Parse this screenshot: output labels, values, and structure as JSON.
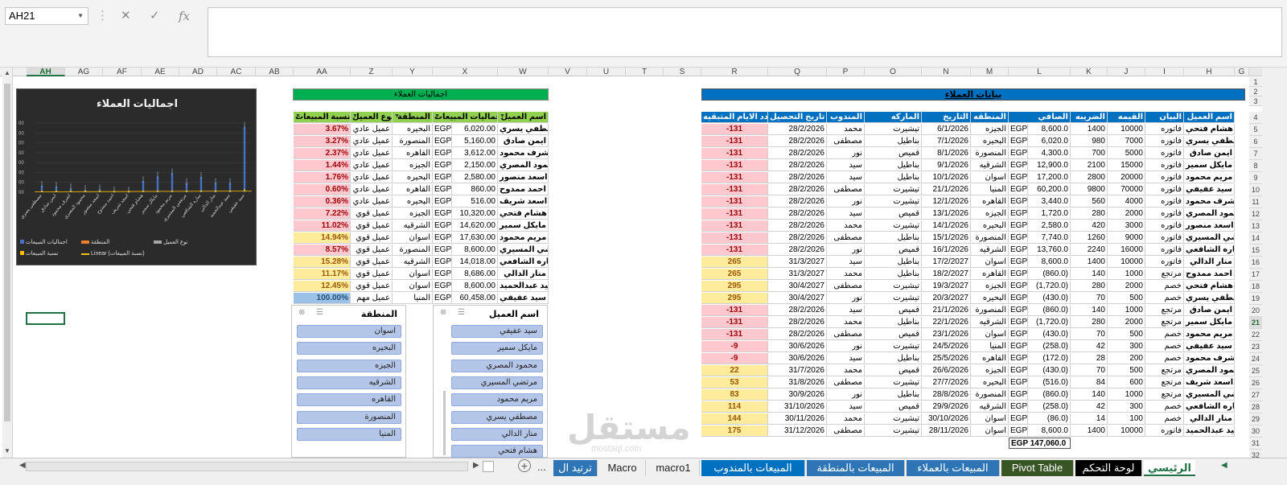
{
  "name_box": "AH21",
  "formula_icons": {
    "cancel": "✕",
    "enter": "✓",
    "fx": "fx"
  },
  "columns": [
    "AH",
    "AG",
    "AF",
    "AE",
    "AD",
    "AC",
    "AB",
    "AA",
    "Z",
    "Y",
    "X",
    "W",
    "V",
    "U",
    "T",
    "S",
    "R",
    "Q",
    "P",
    "O",
    "N",
    "M",
    "L",
    "K",
    "J",
    "I",
    "H",
    "G"
  ],
  "rows": [
    "1",
    "2",
    "3",
    "4",
    "5",
    "6",
    "7",
    "8",
    "9",
    "10",
    "11",
    "12",
    "13",
    "14",
    "15",
    "16",
    "17",
    "18",
    "19",
    "20",
    "21",
    "22",
    "23",
    "24",
    "25",
    "26",
    "27",
    "28",
    "29",
    "30",
    "31",
    "32"
  ],
  "chart": {
    "chart_data": {
      "type": "bar",
      "title": "اجماليات العملاء",
      "categories": [
        "مصطفى يسري",
        "ايمن صادق",
        "اشرف محمود",
        "محمود المصري",
        "اسعد منصور",
        "احمد ممدوح",
        "اسعد شريف",
        "هشام فتحي",
        "مايكل سمير",
        "مريم محمود",
        "مرتضي المسيري",
        "ساره الشافعي",
        "منار الدالي",
        "سيد عبدالحميد",
        "سيد عفيفي"
      ],
      "series": [
        {
          "name": "اجماليات المبيعات",
          "values": [
            6020,
            5160,
            3612,
            2150,
            2580,
            860,
            516,
            10320,
            14620,
            17630,
            8600,
            14018,
            8686,
            8600,
            60458
          ]
        },
        {
          "name": "نسبة المبيعات",
          "values": [
            3.67,
            3.27,
            2.37,
            1.44,
            1.76,
            0.6,
            0.36,
            7.22,
            11.02,
            14.94,
            8.57,
            15.28,
            11.17,
            12.45,
            100.0
          ]
        }
      ],
      "legend": [
        "اجماليات المبيعات",
        "المنطقة",
        "نوع العميل",
        "نسبة المبيعات",
        "Linear (نسبة المبيعات)"
      ]
    }
  },
  "pivot": {
    "title": "اجماليات العملاء",
    "headers": [
      "اسم العميل",
      "اجماليات المبيعات",
      "المنطقة",
      "نوع العميل",
      "نسبة المبيعات"
    ],
    "currency": "EGP",
    "rows": [
      {
        "name": "مصطفي يسري",
        "total": "6,020.00",
        "region": "البحيره",
        "type": "عميل عادي",
        "pct": "3.67%",
        "c": "pink"
      },
      {
        "name": "ايمن صادق",
        "total": "5,160.00",
        "region": "المنصورة",
        "type": "عميل عادي",
        "pct": "3.27%",
        "c": "pink"
      },
      {
        "name": "اشرف محمود",
        "total": "3,612.00",
        "region": "القاهره",
        "type": "عميل عادي",
        "pct": "2.37%",
        "c": "pink"
      },
      {
        "name": "محمود المصري",
        "total": "2,150.00",
        "region": "الجيزه",
        "type": "عميل عادي",
        "pct": "1.44%",
        "c": "pink"
      },
      {
        "name": "اسعد منصور",
        "total": "2,580.00",
        "region": "البحيره",
        "type": "عميل عادي",
        "pct": "1.76%",
        "c": "pink"
      },
      {
        "name": "احمد ممدوح",
        "total": "860.00",
        "region": "القاهره",
        "type": "عميل عادي",
        "pct": "0.60%",
        "c": "pink"
      },
      {
        "name": "اسعد شريف",
        "total": "516.00",
        "region": "البحيره",
        "type": "عميل عادي",
        "pct": "0.36%",
        "c": "pink"
      },
      {
        "name": "هشام فتحي",
        "total": "10,320.00",
        "region": "الجيزه",
        "type": "عميل قوي",
        "pct": "7.22%",
        "c": "pink"
      },
      {
        "name": "مايكل سمير",
        "total": "14,620.00",
        "region": "الشرقيه",
        "type": "عميل قوي",
        "pct": "11.02%",
        "c": "pink"
      },
      {
        "name": "مريم محمود",
        "total": "17,630.00",
        "region": "اسوان",
        "type": "عميل قوي",
        "pct": "14.94%",
        "c": "yel"
      },
      {
        "name": "مرتضي المسيري",
        "total": "8,600.00",
        "region": "المنصورة",
        "type": "عميل قوي",
        "pct": "8.57%",
        "c": "pink"
      },
      {
        "name": "ساره الشافعي",
        "total": "14,018.00",
        "region": "الشرقيه",
        "type": "عميل قوي",
        "pct": "15.28%",
        "c": "yel"
      },
      {
        "name": "منار الدالي",
        "total": "8,686.00",
        "region": "اسوان",
        "type": "عميل قوي",
        "pct": "11.17%",
        "c": "yel"
      },
      {
        "name": "سيد عبدالحميد",
        "total": "8,600.00",
        "region": "اسوان",
        "type": "عميل قوي",
        "pct": "12.45%",
        "c": "yel"
      },
      {
        "name": "سيد عفيفي",
        "total": "60,458.00",
        "region": "المنيا",
        "type": "عميل مهم",
        "pct": "100.00%",
        "c": "blue"
      }
    ]
  },
  "slicer_region": {
    "title": "المنطقة",
    "items": [
      "اسوان",
      "البحيره",
      "الجيزه",
      "الشرقيه",
      "القاهره",
      "المنصورة",
      "المنيا"
    ]
  },
  "slicer_customer": {
    "title": "اسم العميل",
    "items": [
      "سيد عفيفي",
      "مايكل سمير",
      "محمود المصري",
      "مرتضي المسيري",
      "مريم محمود",
      "مصطفي يسري",
      "منار الدالي",
      "هشام فتحي"
    ]
  },
  "data_table": {
    "title": "بيانات العملاء",
    "headers": [
      "اسم العميل",
      "البيان",
      "القيمه",
      "الضريبه",
      "الصافي",
      "المنطقه",
      "التاريخ",
      "الماركه",
      "المندوب",
      "تاريخ التحصيل",
      "عدد الايام المتبقيه"
    ],
    "rows": [
      [
        "هشام فتحي",
        "فاتوره",
        "10000",
        "1400",
        "8,600.0",
        "الجيزه",
        "6/1/2026",
        "تيشيرت",
        "محمد",
        "28/2/2026",
        "-131",
        "pink"
      ],
      [
        "مصطفي يسري",
        "فاتوره",
        "7000",
        "980",
        "6,020.0",
        "البحيره",
        "7/1/2026",
        "بناطيل",
        "مصطفى",
        "28/2/2026",
        "-131",
        "pink"
      ],
      [
        "ايمن صادق",
        "فاتوره",
        "5000",
        "700",
        "4,300.0",
        "المنصورة",
        "8/1/2026",
        "قميص",
        "نور",
        "28/2/2026",
        "-131",
        "pink"
      ],
      [
        "مايكل سمير",
        "فاتوره",
        "15000",
        "2100",
        "12,900.0",
        "الشرقيه",
        "9/1/2026",
        "بناطيل",
        "سيد",
        "28/2/2026",
        "-131",
        "pink"
      ],
      [
        "مريم محمود",
        "فاتوره",
        "20000",
        "2800",
        "17,200.0",
        "اسوان",
        "10/1/2026",
        "بناطيل",
        "سيد",
        "28/2/2026",
        "-131",
        "pink"
      ],
      [
        "سيد عفيفي",
        "فاتوره",
        "70000",
        "9800",
        "60,200.0",
        "المنيا",
        "21/1/2026",
        "تيشيرت",
        "مصطفى",
        "28/2/2026",
        "-131",
        "pink"
      ],
      [
        "اشرف محمود",
        "فاتوره",
        "4000",
        "560",
        "3,440.0",
        "القاهره",
        "12/1/2026",
        "تيشيرت",
        "نور",
        "28/2/2026",
        "-131",
        "pink"
      ],
      [
        "محمود المصري",
        "فاتوره",
        "2000",
        "280",
        "1,720.0",
        "الجيزه",
        "13/1/2026",
        "قميص",
        "سيد",
        "28/2/2026",
        "-131",
        "pink"
      ],
      [
        "اسعد منصور",
        "فاتوره",
        "3000",
        "420",
        "2,580.0",
        "البحيره",
        "14/1/2026",
        "تيشيرت",
        "محمد",
        "28/2/2026",
        "-131",
        "pink"
      ],
      [
        "مرتضي المسيري",
        "فاتوره",
        "9000",
        "1260",
        "7,740.0",
        "المنصورة",
        "15/1/2026",
        "بناطيل",
        "مصطفى",
        "28/2/2026",
        "-131",
        "pink"
      ],
      [
        "ساره الشافعي",
        "فاتوره",
        "16000",
        "2240",
        "13,760.0",
        "الشرقيه",
        "16/1/2026",
        "قميص",
        "نور",
        "28/2/2026",
        "-131",
        "pink"
      ],
      [
        "منار الدالي",
        "فاتوره",
        "10000",
        "1400",
        "8,600.0",
        "اسوان",
        "17/2/2027",
        "بناطيل",
        "سيد",
        "31/3/2027",
        "265",
        "yel"
      ],
      [
        "احمد ممدوح",
        "مرتجع",
        "1000",
        "140",
        "(860.0)",
        "القاهره",
        "18/2/2027",
        "بناطيل",
        "محمد",
        "31/3/2027",
        "265",
        "yel"
      ],
      [
        "هشام فتحي",
        "خصم",
        "2000",
        "280",
        "(1,720.0)",
        "الجيزه",
        "19/3/2027",
        "تيشيرت",
        "مصطفى",
        "30/4/2027",
        "295",
        "yel"
      ],
      [
        "مصطفي يسري",
        "خصم",
        "500",
        "70",
        "(430.0)",
        "البحيره",
        "20/3/2027",
        "تيشيرت",
        "نور",
        "30/4/2027",
        "295",
        "yel"
      ],
      [
        "ايمن صادق",
        "مرتجع",
        "1000",
        "140",
        "(860.0)",
        "المنصورة",
        "21/1/2026",
        "قميص",
        "سيد",
        "28/2/2026",
        "-131",
        "pink"
      ],
      [
        "مايكل سمير",
        "مرتجع",
        "2000",
        "280",
        "(1,720.0)",
        "الشرقيه",
        "22/1/2026",
        "بناطيل",
        "محمد",
        "28/2/2026",
        "-131",
        "pink"
      ],
      [
        "مريم محمود",
        "خصم",
        "500",
        "70",
        "(430.0)",
        "اسوان",
        "23/1/2026",
        "قميص",
        "مصطفى",
        "28/2/2026",
        "-131",
        "pink"
      ],
      [
        "سيد عفيفي",
        "خصم",
        "300",
        "42",
        "(258.0)",
        "المنيا",
        "24/5/2026",
        "تيشيرت",
        "نور",
        "30/6/2026",
        "-9",
        "pink"
      ],
      [
        "اشرف محمود",
        "خصم",
        "200",
        "28",
        "(172.0)",
        "القاهره",
        "25/5/2026",
        "بناطيل",
        "سيد",
        "30/6/2026",
        "-9",
        "pink"
      ],
      [
        "محمود المصري",
        "مرتجع",
        "500",
        "70",
        "(430.0)",
        "الجيزه",
        "26/6/2026",
        "قميص",
        "محمد",
        "31/7/2026",
        "22",
        "yel"
      ],
      [
        "اسعد شريف",
        "مرتجع",
        "600",
        "84",
        "(516.0)",
        "البحيره",
        "27/7/2026",
        "تيشيرت",
        "مصطفى",
        "31/8/2026",
        "53",
        "yel"
      ],
      [
        "مرتضي المسيري",
        "مرتجع",
        "1000",
        "140",
        "(860.0)",
        "المنصورة",
        "28/8/2026",
        "بناطيل",
        "نور",
        "30/9/2026",
        "83",
        "yel"
      ],
      [
        "ساره الشافعي",
        "خصم",
        "300",
        "42",
        "(258.0)",
        "الشرقيه",
        "29/9/2026",
        "قميص",
        "سيد",
        "31/10/2026",
        "114",
        "yel"
      ],
      [
        "منار الدالي",
        "خصم",
        "100",
        "14",
        "(86.0)",
        "اسوان",
        "30/10/2026",
        "تيشيرت",
        "محمد",
        "30/11/2026",
        "144",
        "yel"
      ],
      [
        "سيد عبدالحميد",
        "فاتوره",
        "10000",
        "1400",
        "8,600.0",
        "اسوان",
        "28/11/2026",
        "تيشيرت",
        "مصطفى",
        "31/12/2026",
        "175",
        "yel"
      ]
    ],
    "total": "EGP 147,060.0",
    "currency": "EGP"
  },
  "tabs": [
    {
      "label": "الرئيسي",
      "bg": "#ffffff",
      "fg": "#217346",
      "active": true
    },
    {
      "label": "لوحة التحكم",
      "bg": "#000000",
      "fg": "#ffffff"
    },
    {
      "label": "Pivot Table",
      "bg": "#375623",
      "fg": "#ffffff"
    },
    {
      "label": "المبيعات بالعملاء",
      "bg": "#2e75b6",
      "fg": "#ffffff"
    },
    {
      "label": "المبيعات بالمنطقة",
      "bg": "#2e75b6",
      "fg": "#ffffff"
    },
    {
      "label": "المبيعات بالمندوب",
      "bg": "#0070c0",
      "fg": "#ffffff"
    },
    {
      "label": "macro1",
      "bg": "#f0f0f0",
      "fg": "#222222"
    },
    {
      "label": "Macro",
      "bg": "#f0f0f0",
      "fg": "#222222"
    },
    {
      "label": "ترتيد ال",
      "bg": "#2e75b6",
      "fg": "#ffffff"
    }
  ],
  "tab_more": "...",
  "watermark": "مستقل",
  "watermark_sub": "mostaql.com"
}
